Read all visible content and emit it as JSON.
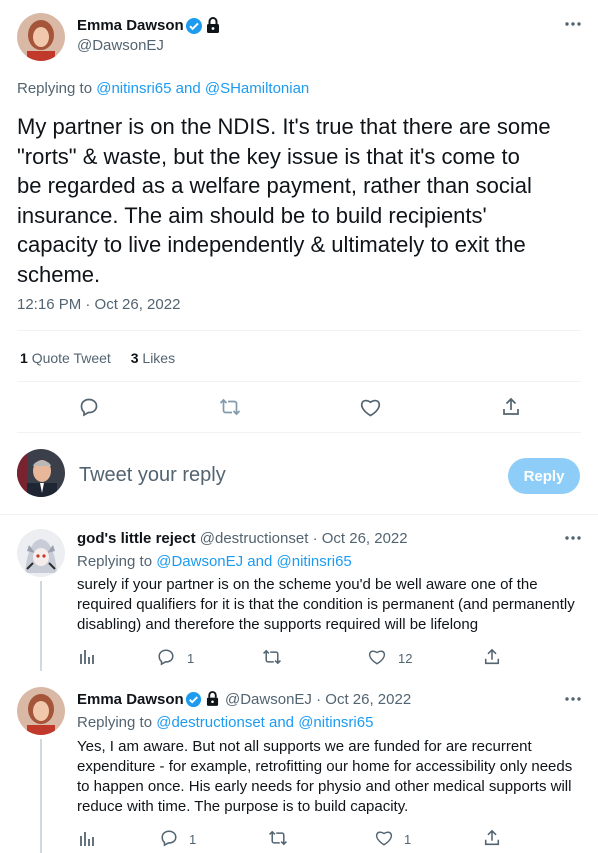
{
  "main_tweet": {
    "author_name": "Emma Dawson",
    "author_handle": "@DawsonEJ",
    "replying_prefix": "Replying to",
    "replying_to": "@nitinsri65 and @SHamiltonian",
    "text_lines": [
      "My partner is on the NDIS. It's true that there are some",
      "\"rorts\" & waste, but the key issue is that it's come to",
      "be regarded as a welfare payment, rather than social",
      "insurance. The aim should be to build recipients'",
      "capacity to live independently & ultimately to exit the",
      "scheme."
    ],
    "timestamp": "12:16 PM · Oct 26, 2022",
    "stats": {
      "quote_count": "1",
      "quote_label": "Quote Tweet",
      "like_count": "3",
      "like_label": "Likes"
    },
    "more_icon": "more-dots-icon"
  },
  "composer": {
    "placeholder": "Tweet your reply",
    "button_label": "Reply",
    "button_color": "#8ecdf8"
  },
  "replies": [
    {
      "author_name": "god's little reject",
      "author_handle": "@destructionset",
      "date": "· Oct 26, 2022",
      "replying_prefix": "Replying to",
      "replying_to": "@DawsonEJ and @nitinsri65",
      "text_lines": [
        "surely if your partner is on the scheme you'd be well aware one of the",
        "required qualifiers for it is that the condition is permanent (and permanently",
        "disabling) and therefore the supports required will be lifelong"
      ],
      "reply_count": "1",
      "retweet_count": "",
      "like_count": "12"
    },
    {
      "author_name": "Emma Dawson",
      "author_handle": "@DawsonEJ",
      "date": "· Oct 26, 2022",
      "replying_prefix": "Replying to",
      "replying_to": "@destructionset and @nitinsri65",
      "text_lines": [
        "Yes, I am aware. But not all supports we are funded for are recurrent",
        "expenditure - for example, retrofitting our home for accessibility only needs",
        "to happen once. His early needs for physio and other medical supports will",
        "reduce with time. The purpose is to build capacity."
      ],
      "reply_count": "1",
      "retweet_count": "",
      "like_count": "1"
    }
  ],
  "colors": {
    "accent": "#1d9bf0",
    "verified": "#1d9bf0",
    "muted": "#536471",
    "divider": "#eff3f4"
  }
}
